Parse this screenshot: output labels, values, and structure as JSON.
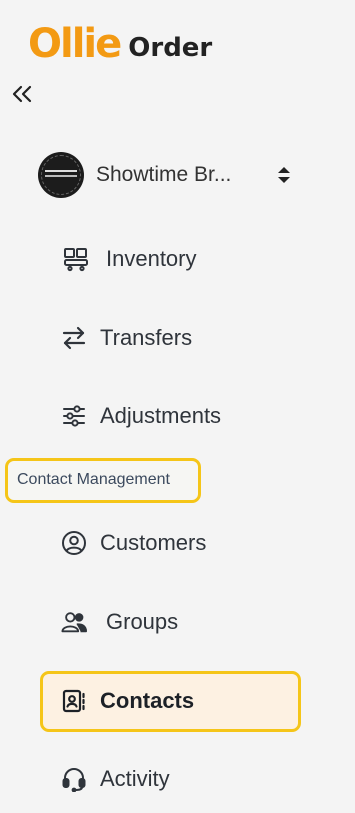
{
  "brand": {
    "logo_primary": "Ollie",
    "logo_secondary": "Order",
    "logo_color": "#f39a13"
  },
  "org": {
    "name": "Showtime Br..."
  },
  "nav": {
    "inventory": "Inventory",
    "transfers": "Transfers",
    "adjustments": "Adjustments",
    "section_contact": "Contact Management",
    "customers": "Customers",
    "groups": "Groups",
    "contacts": "Contacts",
    "activity": "Activity"
  },
  "colors": {
    "highlight": "#f5c518",
    "active_bg": "#fdf1e2",
    "bg": "#f4f4f4"
  },
  "icons": {
    "collapse": "double-chevron-left-icon",
    "inventory": "inventory-boxes-icon",
    "transfers": "transfer-arrows-icon",
    "adjustments": "sliders-icon",
    "customers": "user-circle-icon",
    "groups": "users-icon",
    "contacts": "contact-card-icon",
    "activity": "headset-icon"
  }
}
